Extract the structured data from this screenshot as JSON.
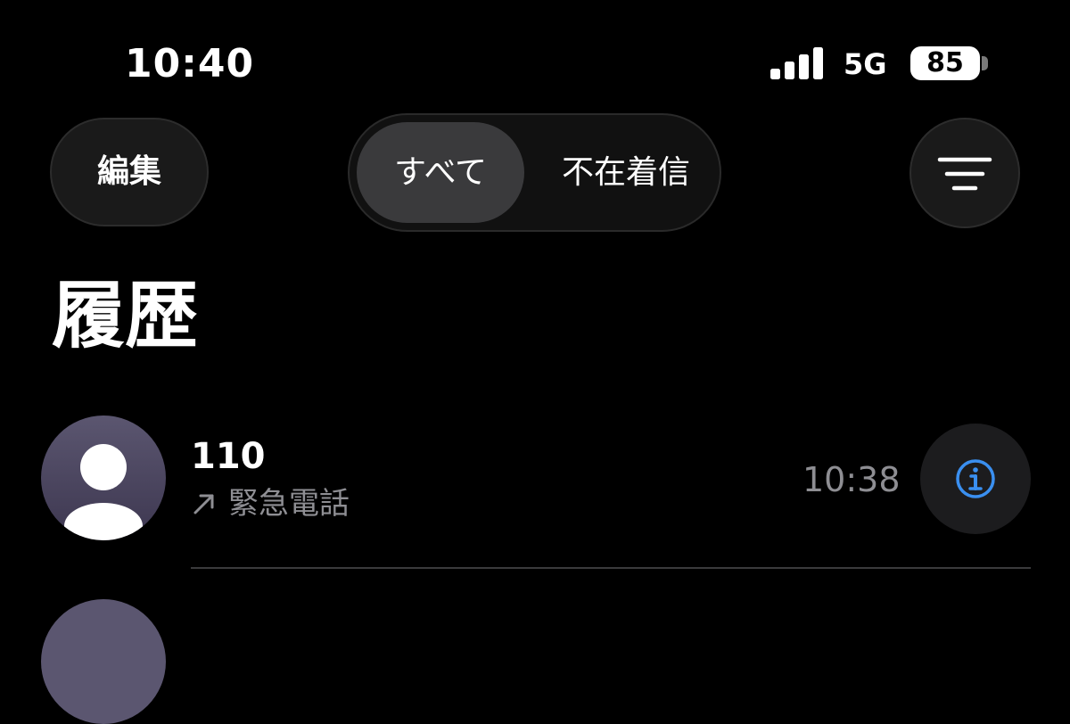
{
  "status_bar": {
    "time": "10:40",
    "network": "5G",
    "battery": "85"
  },
  "header": {
    "edit_label": "編集",
    "segments": [
      {
        "label": "すべて",
        "selected": true
      },
      {
        "label": "不在着信",
        "selected": false
      }
    ],
    "filter_icon": "filter-lines-icon"
  },
  "page": {
    "title": "履歴"
  },
  "calls": [
    {
      "caller": "110",
      "direction_icon": "outgoing-arrow-icon",
      "type": "緊急電話",
      "time": "10:38",
      "info_icon": "info-icon"
    }
  ],
  "colors": {
    "background": "#000000",
    "accent": "#3a8ff0",
    "secondary_text": "#8e8e93",
    "control_fill": "#1a1a1a",
    "segment_selected": "#3a3a3c"
  }
}
